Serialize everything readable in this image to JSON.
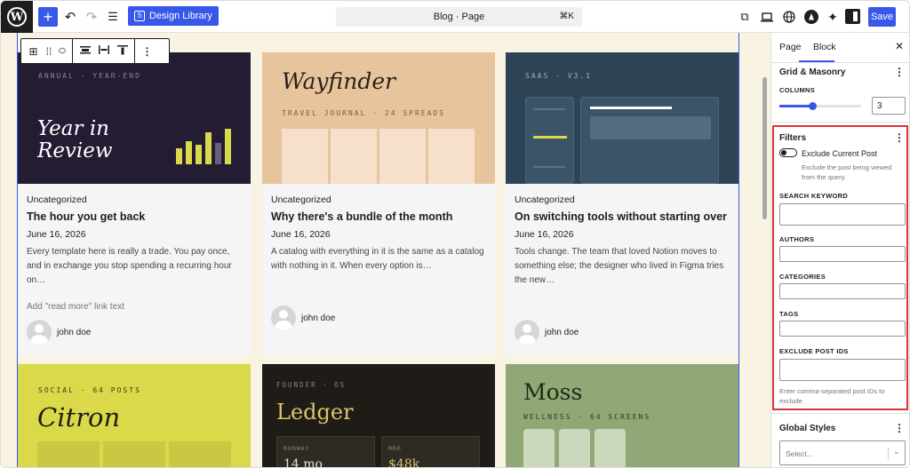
{
  "topbar": {
    "add_label": "+",
    "undo_icon": "undo-icon",
    "redo_icon": "redo-icon",
    "list_view_icon": "list-view-icon",
    "design_library_label": "Design Library",
    "command": {
      "title": "Blog · Page",
      "shortcut": "⌘K"
    },
    "save_label": "Save",
    "icons": [
      "external-link-icon",
      "device-preview-icon",
      "globe-icon",
      "astra-icon",
      "sparkle-icon",
      "sidebar-toggle-icon"
    ]
  },
  "block_toolbar": {
    "icons": [
      "query-loop-icon",
      "drag-icon",
      "move-up-icon",
      "move-down-icon",
      "justify-icon",
      "width-icon",
      "align-top-icon",
      "more-options-icon"
    ]
  },
  "cards": [
    {
      "thumb": {
        "kicker": "ANNUAL · YEAR-END",
        "headline_1": "Year in",
        "headline_2": "Review",
        "bg": "#231c33"
      },
      "category": "Uncategorized",
      "title": "The hour you get back",
      "date": "June 16, 2026",
      "excerpt": "Every template here is really a trade. You pay once, and in exchange you stop spending a recurring hour on…",
      "read_more": "Add \"read more\" link text",
      "author": "john doe"
    },
    {
      "thumb": {
        "headline": "Wayfinder",
        "kicker": "TRAVEL JOURNAL · 24 SPREADS",
        "bg": "#e8c49c"
      },
      "category": "Uncategorized",
      "title": "Why there's a bundle of the month",
      "date": "June 16, 2026",
      "excerpt": "A catalog with everything in it is the same as a catalog with nothing in it. When every option is…",
      "author": "john doe"
    },
    {
      "thumb": {
        "kicker": "SAAS · V3.1",
        "bg": "#2d4356"
      },
      "category": "Uncategorized",
      "title": "On switching tools without starting over",
      "date": "June 16, 2026",
      "excerpt": "Tools change. The team that loved Notion moves to something else; the designer who lived in Figma tries the new…",
      "author": "john doe"
    },
    {
      "thumb": {
        "kicker": "SOCIAL · 64 POSTS",
        "headline": "Citron",
        "bg": "#d9d949"
      }
    },
    {
      "thumb": {
        "kicker": "FOUNDER · OS",
        "headline": "Ledger",
        "bg": "#1f1c17",
        "stats": [
          {
            "label": "RUNWAY",
            "value": "14 mo"
          },
          {
            "label": "MRR",
            "value": "$48k"
          }
        ]
      }
    },
    {
      "thumb": {
        "headline": "Moss",
        "kicker": "WELLNESS · 64 SCREENS",
        "bg": "#8fa876"
      }
    }
  ],
  "sidebar": {
    "tabs": [
      "Page",
      "Block"
    ],
    "active_tab": "Block",
    "panel_title": "Grid & Masonry",
    "columns_label": "COLUMNS",
    "columns_value": "3",
    "columns_fraction": 0.33,
    "filters": {
      "title": "Filters",
      "exclude_current_label": "Exclude Current Post",
      "exclude_current_help": "Exclude the post being viewed from the query.",
      "exclude_current_on": false,
      "search_label": "SEARCH KEYWORD",
      "authors_label": "AUTHORS",
      "categories_label": "CATEGORIES",
      "tags_label": "TAGS",
      "exclude_ids_label": "EXCLUDE POST IDS",
      "exclude_ids_help": "Enter comma-separated post IDs to exclude."
    },
    "global_styles": {
      "title": "Global Styles",
      "select_placeholder": "Select..."
    }
  },
  "colors": {
    "accent": "#3858e9",
    "highlight": "#e03030"
  }
}
